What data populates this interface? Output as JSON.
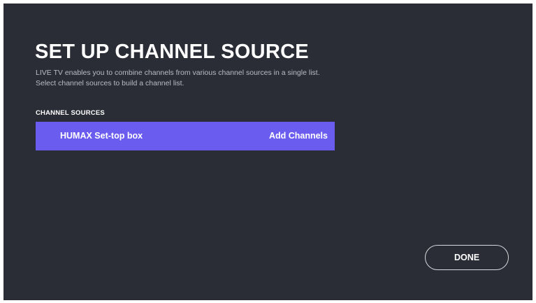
{
  "screen": {
    "title": "SET UP CHANNEL SOURCE",
    "description": [
      "LIVE TV enables you to combine channels from various channel sources in a single list.",
      "Select channel sources to build a channel list."
    ]
  },
  "channel_sources": {
    "label": "CHANNEL SOURCES",
    "items": [
      {
        "name": "HUMAX Set-top box",
        "action": "Add Channels"
      }
    ]
  },
  "footer": {
    "done_label": "DONE"
  },
  "colors": {
    "background": "#2a2d36",
    "accent": "#6b5cf0",
    "text": "#ffffff",
    "secondary_text": "#b9bcc4"
  }
}
